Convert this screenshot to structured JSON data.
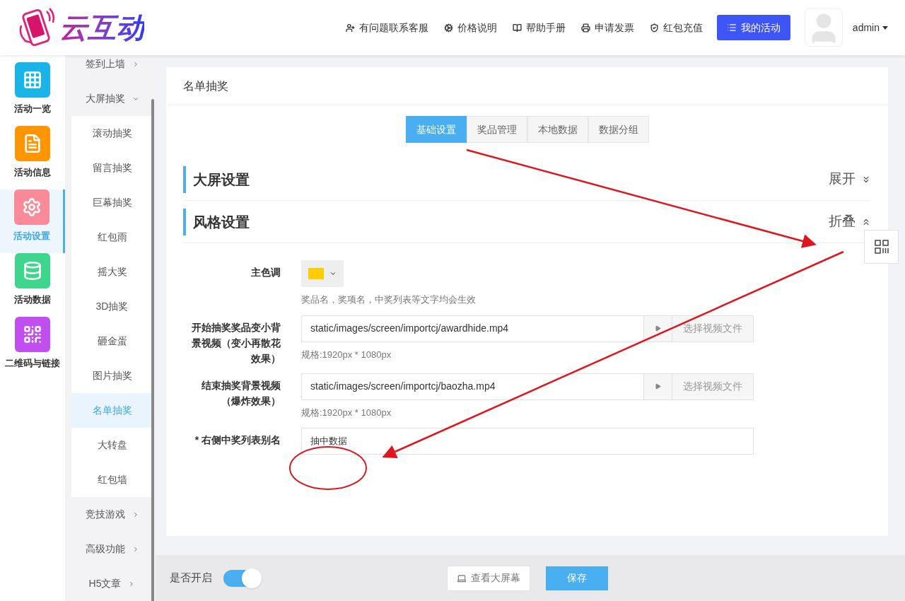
{
  "header": {
    "logo_text": "云互动",
    "links": [
      {
        "kind": "user-plus",
        "label": "有问题联系客服"
      },
      {
        "kind": "gear",
        "label": "价格说明"
      },
      {
        "kind": "book",
        "label": "帮助手册"
      },
      {
        "kind": "printer",
        "label": "申请发票"
      },
      {
        "kind": "shield",
        "label": "红包充值"
      }
    ],
    "primary_button": "我的活动",
    "user": "admin"
  },
  "nav": [
    {
      "kind": "grid",
      "label": "活动一览",
      "color": "#1ab4e8",
      "selected": false
    },
    {
      "kind": "file",
      "label": "活动信息",
      "color": "#ff9500",
      "selected": false
    },
    {
      "kind": "gear",
      "label": "活动设置",
      "color": "#f98a98",
      "selected": true
    },
    {
      "kind": "database",
      "label": "活动数据",
      "color": "#3dd68c",
      "selected": false
    },
    {
      "kind": "qr",
      "label": "二维码与链接",
      "color": "#c14ff0",
      "selected": false
    }
  ],
  "submenu": [
    {
      "label": "签到上墙",
      "expanded": false
    },
    {
      "label": "大屏抽奖",
      "expanded": true,
      "children": [
        {
          "label": "滚动抽奖",
          "selected": false
        },
        {
          "label": "留言抽奖",
          "selected": false
        },
        {
          "label": "巨幕抽奖",
          "selected": false
        },
        {
          "label": "红包雨",
          "selected": false
        },
        {
          "label": "摇大奖",
          "selected": false
        },
        {
          "label": "3D抽奖",
          "selected": false
        },
        {
          "label": "砸金蛋",
          "selected": false
        },
        {
          "label": "图片抽奖",
          "selected": false
        },
        {
          "label": "名单抽奖",
          "selected": true
        },
        {
          "label": "大转盘",
          "selected": false
        },
        {
          "label": "红包墙",
          "selected": false
        }
      ]
    },
    {
      "label": "竞技游戏",
      "expanded": false
    },
    {
      "label": "高级功能",
      "expanded": false
    },
    {
      "label": "H5文章",
      "expanded": false
    }
  ],
  "card": {
    "title": "名单抽奖",
    "tabs": [
      {
        "label": "基础设置",
        "selected": true
      },
      {
        "label": "奖品管理",
        "selected": false
      },
      {
        "label": "本地数据",
        "selected": false
      },
      {
        "label": "数据分组",
        "selected": false
      }
    ],
    "sections": [
      {
        "title": "大屏设置",
        "toggle_label": "展开",
        "expanded": false
      },
      {
        "title": "风格设置",
        "toggle_label": "折叠",
        "expanded": true,
        "fields": [
          {
            "kind": "color",
            "label": "主色调",
            "color": "#ffcc00",
            "hint": "奖品名，奖项名，中奖列表等文字均会生效"
          },
          {
            "kind": "file",
            "label": "开始抽奖奖品变小背景视频（变小再散花效果）",
            "value": "static/images/screen/importcj/awardhide.mp4",
            "button": "选择视频文件",
            "hint": "规格:1920px * 1080px"
          },
          {
            "kind": "file",
            "label": "结束抽奖背景视频（爆炸效果）",
            "value": "static/images/screen/importcj/baozha.mp4",
            "button": "选择视频文件",
            "hint": "规格:1920px * 1080px"
          },
          {
            "kind": "text",
            "label": "* 右侧中奖列表别名",
            "value": "抽中数据"
          }
        ]
      }
    ]
  },
  "bottom_bar": {
    "toggle_label": "是否开启",
    "on": true,
    "preview_button": "查看大屏幕",
    "save_button": "保存"
  }
}
